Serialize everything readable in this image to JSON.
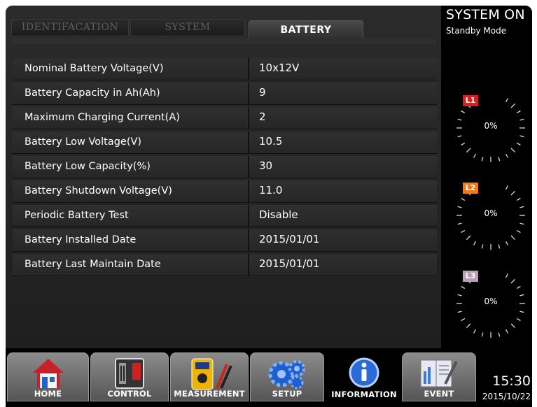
{
  "tabs": [
    {
      "label": "IDENTIFACATION",
      "active": false
    },
    {
      "label": "SYSTEM",
      "active": false
    },
    {
      "label": "BATTERY",
      "active": true
    }
  ],
  "battery_info": [
    {
      "label": "Nominal Battery Voltage(V)",
      "value": "10x12V"
    },
    {
      "label": "Battery Capacity in Ah(Ah)",
      "value": "9"
    },
    {
      "label": "Maximum Charging Current(A)",
      "value": "2"
    },
    {
      "label": "Battery Low Voltage(V)",
      "value": "10.5"
    },
    {
      "label": "Battery Low Capacity(%)",
      "value": "30"
    },
    {
      "label": "Battery Shutdown Voltage(V)",
      "value": "11.0"
    },
    {
      "label": "Periodic Battery Test",
      "value": "Disable"
    },
    {
      "label": "Battery Installed Date",
      "value": "2015/01/01"
    },
    {
      "label": "Battery Last Maintain Date",
      "value": "2015/01/01"
    }
  ],
  "status": {
    "title": "SYSTEM ON",
    "mode": "Standby Mode"
  },
  "gauges": [
    {
      "label": "L1",
      "value": "0%",
      "color": "#d81e1e"
    },
    {
      "label": "L2",
      "value": "0%",
      "color": "#f07a1a"
    },
    {
      "label": "L3",
      "value": "0%",
      "color": "#b9a0b9"
    }
  ],
  "clock": {
    "time": "15:30",
    "date": "2015/10/22"
  },
  "nav": [
    {
      "label": "HOME",
      "icon": "home-icon"
    },
    {
      "label": "CONTROL",
      "icon": "control-icon"
    },
    {
      "label": "MEASUREMENT",
      "icon": "multimeter-icon"
    },
    {
      "label": "SETUP",
      "icon": "gears-icon"
    },
    {
      "label": "INFORMATION",
      "icon": "info-icon",
      "active": true
    },
    {
      "label": "EVENT",
      "icon": "event-log-icon"
    }
  ]
}
